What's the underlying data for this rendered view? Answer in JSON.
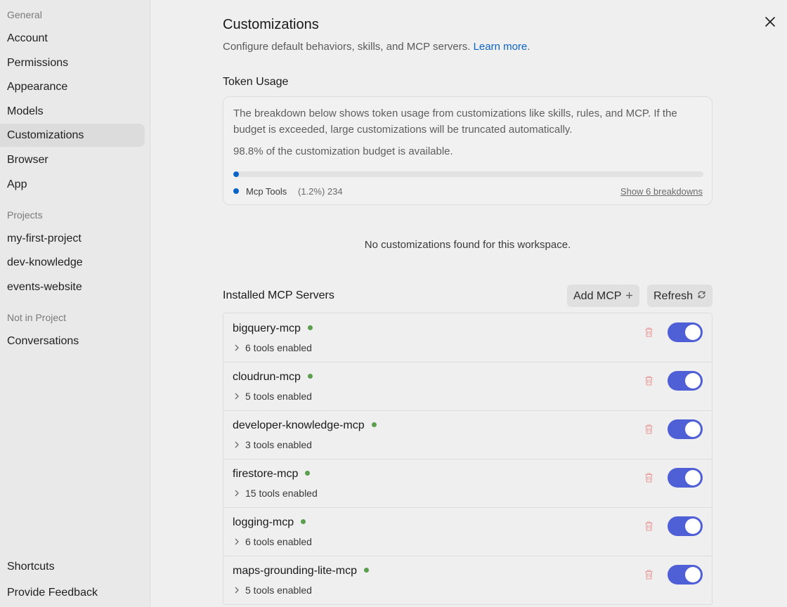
{
  "sidebar": {
    "general_label": "General",
    "general_items": [
      "Account",
      "Permissions",
      "Appearance",
      "Models",
      "Customizations",
      "Browser",
      "App"
    ],
    "projects_label": "Projects",
    "project_items": [
      "my-first-project",
      "dev-knowledge",
      "events-website"
    ],
    "not_in_project_label": "Not in Project",
    "not_in_project_items": [
      "Conversations"
    ],
    "footer_items": [
      "Shortcuts",
      "Provide Feedback"
    ],
    "active_item": "Customizations"
  },
  "page": {
    "title": "Customizations",
    "subtitle": "Configure default behaviors, skills, and MCP servers.",
    "learn_more": "Learn more",
    "subtitle_end": "."
  },
  "token_usage": {
    "heading": "Token Usage",
    "description": "The breakdown below shows token usage from customizations like skills, rules, and MCP. If the budget is exceeded, large customizations will be truncated automatically.",
    "available_text": "98.8% of the customization budget is available.",
    "used_fraction": 0.012,
    "legend_name": "Mcp Tools",
    "legend_value": "(1.2%) 234",
    "breakdowns_link": "Show 6 breakdowns",
    "accent_color": "#0b63c4"
  },
  "empty_message": "No customizations found for this workspace.",
  "mcp": {
    "heading": "Installed MCP Servers",
    "add_label": "Add MCP",
    "add_icon": "plus-icon",
    "refresh_label": "Refresh",
    "refresh_icon": "refresh-icon",
    "toggle_color": "#4f5fd6",
    "status_color": "#5a9e4e",
    "servers": [
      {
        "name": "bigquery-mcp",
        "tools": "6 tools enabled",
        "enabled": true
      },
      {
        "name": "cloudrun-mcp",
        "tools": "5 tools enabled",
        "enabled": true
      },
      {
        "name": "developer-knowledge-mcp",
        "tools": "3 tools enabled",
        "enabled": true
      },
      {
        "name": "firestore-mcp",
        "tools": "15 tools enabled",
        "enabled": true
      },
      {
        "name": "logging-mcp",
        "tools": "6 tools enabled",
        "enabled": true
      },
      {
        "name": "maps-grounding-lite-mcp",
        "tools": "5 tools enabled",
        "enabled": true
      }
    ]
  }
}
